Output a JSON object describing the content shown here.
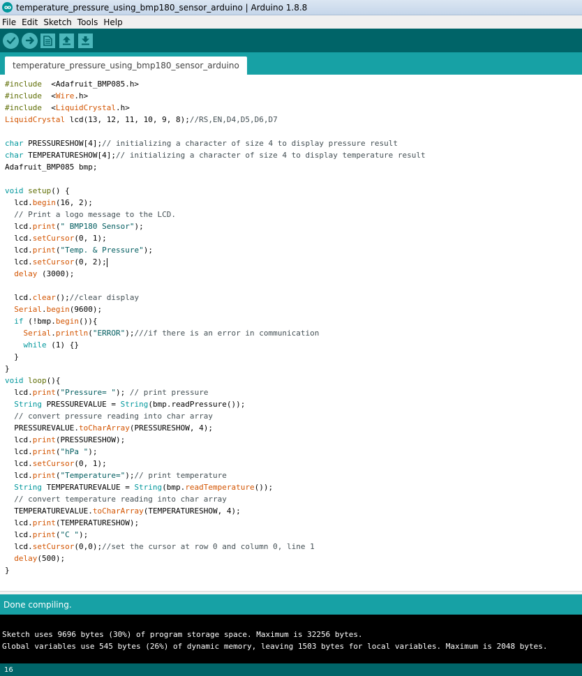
{
  "window": {
    "title": "temperature_pressure_using_bmp180_sensor_arduino | Arduino 1.8.8",
    "icon_label": "oo"
  },
  "menu": [
    "File",
    "Edit",
    "Sketch",
    "Tools",
    "Help"
  ],
  "toolbar": {
    "icons": [
      "verify-icon",
      "upload-icon",
      "new-icon",
      "open-icon",
      "save-icon"
    ]
  },
  "tab": {
    "label": "temperature_pressure_using_bmp180_sensor_arduino"
  },
  "code": [
    [
      [
        "pp",
        "#include"
      ],
      [
        "",
        "  <Adafruit_BMP085.h>"
      ]
    ],
    [
      [
        "pp",
        "#include"
      ],
      [
        "",
        "  <"
      ],
      [
        "fn",
        "Wire"
      ],
      [
        "",
        ".h>"
      ]
    ],
    [
      [
        "pp",
        "#include"
      ],
      [
        "",
        "  <"
      ],
      [
        "fn",
        "LiquidCrystal"
      ],
      [
        "",
        ".h>"
      ]
    ],
    [
      [
        "fn",
        "LiquidCrystal"
      ],
      [
        "",
        " lcd(13, 12, 11, 10, 9, 8);"
      ],
      [
        "cm",
        "//RS,EN,D4,D5,D6,D7"
      ]
    ],
    [],
    [
      [
        "kw",
        "char"
      ],
      [
        "",
        " PRESSURESHOW[4];"
      ],
      [
        "cm",
        "// initializing a character of size 4 to display pressure result"
      ]
    ],
    [
      [
        "kw",
        "char"
      ],
      [
        "",
        " TEMPERATURESHOW[4];"
      ],
      [
        "cm",
        "// initializing a character of size 4 to display temperature result"
      ]
    ],
    [
      [
        "",
        "Adafruit_BMP085 bmp;"
      ]
    ],
    [],
    [
      [
        "kw",
        "void"
      ],
      [
        "",
        " "
      ],
      [
        "pp",
        "setup"
      ],
      [
        "",
        "() {"
      ]
    ],
    [
      [
        "",
        "  lcd."
      ],
      [
        "fn",
        "begin"
      ],
      [
        "",
        "(16, 2);"
      ]
    ],
    [
      [
        "cm",
        "  // Print a logo message to the LCD."
      ]
    ],
    [
      [
        "",
        "  lcd."
      ],
      [
        "fn",
        "print"
      ],
      [
        "",
        "("
      ],
      [
        "st",
        "\" BMP180 Sensor\""
      ],
      [
        "",
        ");"
      ]
    ],
    [
      [
        "",
        "  lcd."
      ],
      [
        "fn",
        "setCursor"
      ],
      [
        "",
        "(0, 1);"
      ]
    ],
    [
      [
        "",
        "  lcd."
      ],
      [
        "fn",
        "print"
      ],
      [
        "",
        "("
      ],
      [
        "st",
        "\"Temp. & Pressure\""
      ],
      [
        "",
        ");"
      ]
    ],
    [
      [
        "",
        "  lcd."
      ],
      [
        "fn",
        "setCursor"
      ],
      [
        "",
        "(0, 2);"
      ],
      [
        "caret",
        ""
      ]
    ],
    [
      [
        "fn",
        "  delay"
      ],
      [
        "",
        " (3000);"
      ]
    ],
    [],
    [
      [
        "",
        "  lcd."
      ],
      [
        "fn",
        "clear"
      ],
      [
        "",
        "();"
      ],
      [
        "cm",
        "//clear display"
      ]
    ],
    [
      [
        "fn",
        "  Serial"
      ],
      [
        "",
        "."
      ],
      [
        "fn",
        "begin"
      ],
      [
        "",
        "(9600);"
      ]
    ],
    [
      [
        "kw",
        "  if"
      ],
      [
        "",
        " (!bmp."
      ],
      [
        "fn",
        "begin"
      ],
      [
        "",
        "()){"
      ]
    ],
    [
      [
        "fn",
        "    Serial"
      ],
      [
        "",
        "."
      ],
      [
        "fn",
        "println"
      ],
      [
        "",
        "("
      ],
      [
        "st",
        "\"ERROR\""
      ],
      [
        "",
        ");"
      ],
      [
        "cm",
        "///if there is an error in communication"
      ]
    ],
    [
      [
        "kw",
        "    while"
      ],
      [
        "",
        " (1) {}"
      ]
    ],
    [
      [
        "",
        "  }"
      ]
    ],
    [
      [
        "",
        "}"
      ]
    ],
    [
      [
        "kw",
        "void"
      ],
      [
        "",
        " "
      ],
      [
        "pp",
        "loop"
      ],
      [
        "",
        "(){"
      ]
    ],
    [
      [
        "",
        "  lcd."
      ],
      [
        "fn",
        "print"
      ],
      [
        "",
        "("
      ],
      [
        "st",
        "\"Pressure= \""
      ],
      [
        "",
        "); "
      ],
      [
        "cm",
        "// print pressure"
      ]
    ],
    [
      [
        "kw",
        "  String"
      ],
      [
        "",
        " PRESSUREVALUE = "
      ],
      [
        "kw",
        "String"
      ],
      [
        "",
        "(bmp.readPressure());"
      ]
    ],
    [
      [
        "cm",
        "  // convert pressure reading into char array"
      ]
    ],
    [
      [
        "",
        "  PRESSUREVALUE."
      ],
      [
        "fn",
        "toCharArray"
      ],
      [
        "",
        "(PRESSURESHOW, 4);"
      ]
    ],
    [
      [
        "",
        "  lcd."
      ],
      [
        "fn",
        "print"
      ],
      [
        "",
        "(PRESSURESHOW);"
      ]
    ],
    [
      [
        "",
        "  lcd."
      ],
      [
        "fn",
        "print"
      ],
      [
        "",
        "("
      ],
      [
        "st",
        "\"hPa \""
      ],
      [
        "",
        ");"
      ]
    ],
    [
      [
        "",
        "  lcd."
      ],
      [
        "fn",
        "setCursor"
      ],
      [
        "",
        "(0, 1);"
      ]
    ],
    [
      [
        "",
        "  lcd."
      ],
      [
        "fn",
        "print"
      ],
      [
        "",
        "("
      ],
      [
        "st",
        "\"Temperature=\""
      ],
      [
        "",
        ");"
      ],
      [
        "cm",
        "// print temperature"
      ]
    ],
    [
      [
        "kw",
        "  String"
      ],
      [
        "",
        " TEMPERATUREVALUE = "
      ],
      [
        "kw",
        "String"
      ],
      [
        "",
        "(bmp."
      ],
      [
        "fn",
        "readTemperature"
      ],
      [
        "",
        "());"
      ]
    ],
    [
      [
        "cm",
        "  // convert temperature reading into char array"
      ]
    ],
    [
      [
        "",
        "  TEMPERATUREVALUE."
      ],
      [
        "fn",
        "toCharArray"
      ],
      [
        "",
        "(TEMPERATURESHOW, 4);"
      ]
    ],
    [
      [
        "",
        "  lcd."
      ],
      [
        "fn",
        "print"
      ],
      [
        "",
        "(TEMPERATURESHOW);"
      ]
    ],
    [
      [
        "",
        "  lcd."
      ],
      [
        "fn",
        "print"
      ],
      [
        "",
        "("
      ],
      [
        "st",
        "\"C \""
      ],
      [
        "",
        ");"
      ]
    ],
    [
      [
        "",
        "  lcd."
      ],
      [
        "fn",
        "setCursor"
      ],
      [
        "",
        "(0,0);"
      ],
      [
        "cm",
        "//set the cursor at row 0 and column 0, line 1"
      ]
    ],
    [
      [
        "fn",
        "  delay"
      ],
      [
        "",
        "(500);"
      ]
    ],
    [
      [
        "",
        "}"
      ]
    ]
  ],
  "status": {
    "message": "Done compiling."
  },
  "console": {
    "lines": [
      "Sketch uses 9696 bytes (30%) of program storage space. Maximum is 32256 bytes.",
      "Global variables use 545 bytes (26%) of dynamic memory, leaving 1503 bytes for local variables. Maximum is 2048 bytes."
    ]
  },
  "footer": {
    "line_number": "16"
  },
  "colors": {
    "teal_dark": "#006468",
    "teal": "#17a1a5",
    "keyword": "#00979c",
    "function": "#d35400"
  }
}
